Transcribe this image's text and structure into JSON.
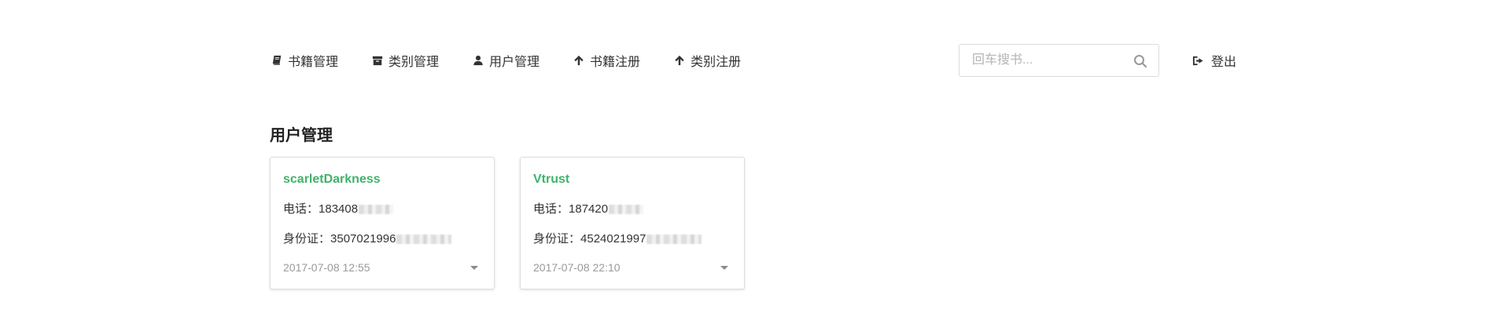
{
  "nav": {
    "items": [
      {
        "label": "书籍管理",
        "icon": "book-icon"
      },
      {
        "label": "类别管理",
        "icon": "archive-icon"
      },
      {
        "label": "用户管理",
        "icon": "user-icon"
      },
      {
        "label": "书籍注册",
        "icon": "arrow-up-icon"
      },
      {
        "label": "类别注册",
        "icon": "arrow-up-icon"
      }
    ]
  },
  "search": {
    "placeholder": "回车搜书...",
    "value": "",
    "icon": "search-icon"
  },
  "logout": {
    "label": "登出",
    "icon": "sign-out-icon"
  },
  "section": {
    "title": "用户管理"
  },
  "users": [
    {
      "name": "scarletDarkness",
      "phone_label": "电话：",
      "phone_visible": "183408",
      "id_label": "身份证：",
      "id_visible": "3507021996",
      "date": "2017-07-08 12:55"
    },
    {
      "name": "Vtrust",
      "phone_label": "电话：",
      "phone_visible": "187420",
      "id_label": "身份证：",
      "id_visible": "4524021997",
      "date": "2017-07-08 22:10"
    }
  ],
  "colors": {
    "accent_green": "#3fb36a",
    "text": "#333333",
    "muted": "#9a9a9a",
    "border": "#dedede"
  }
}
